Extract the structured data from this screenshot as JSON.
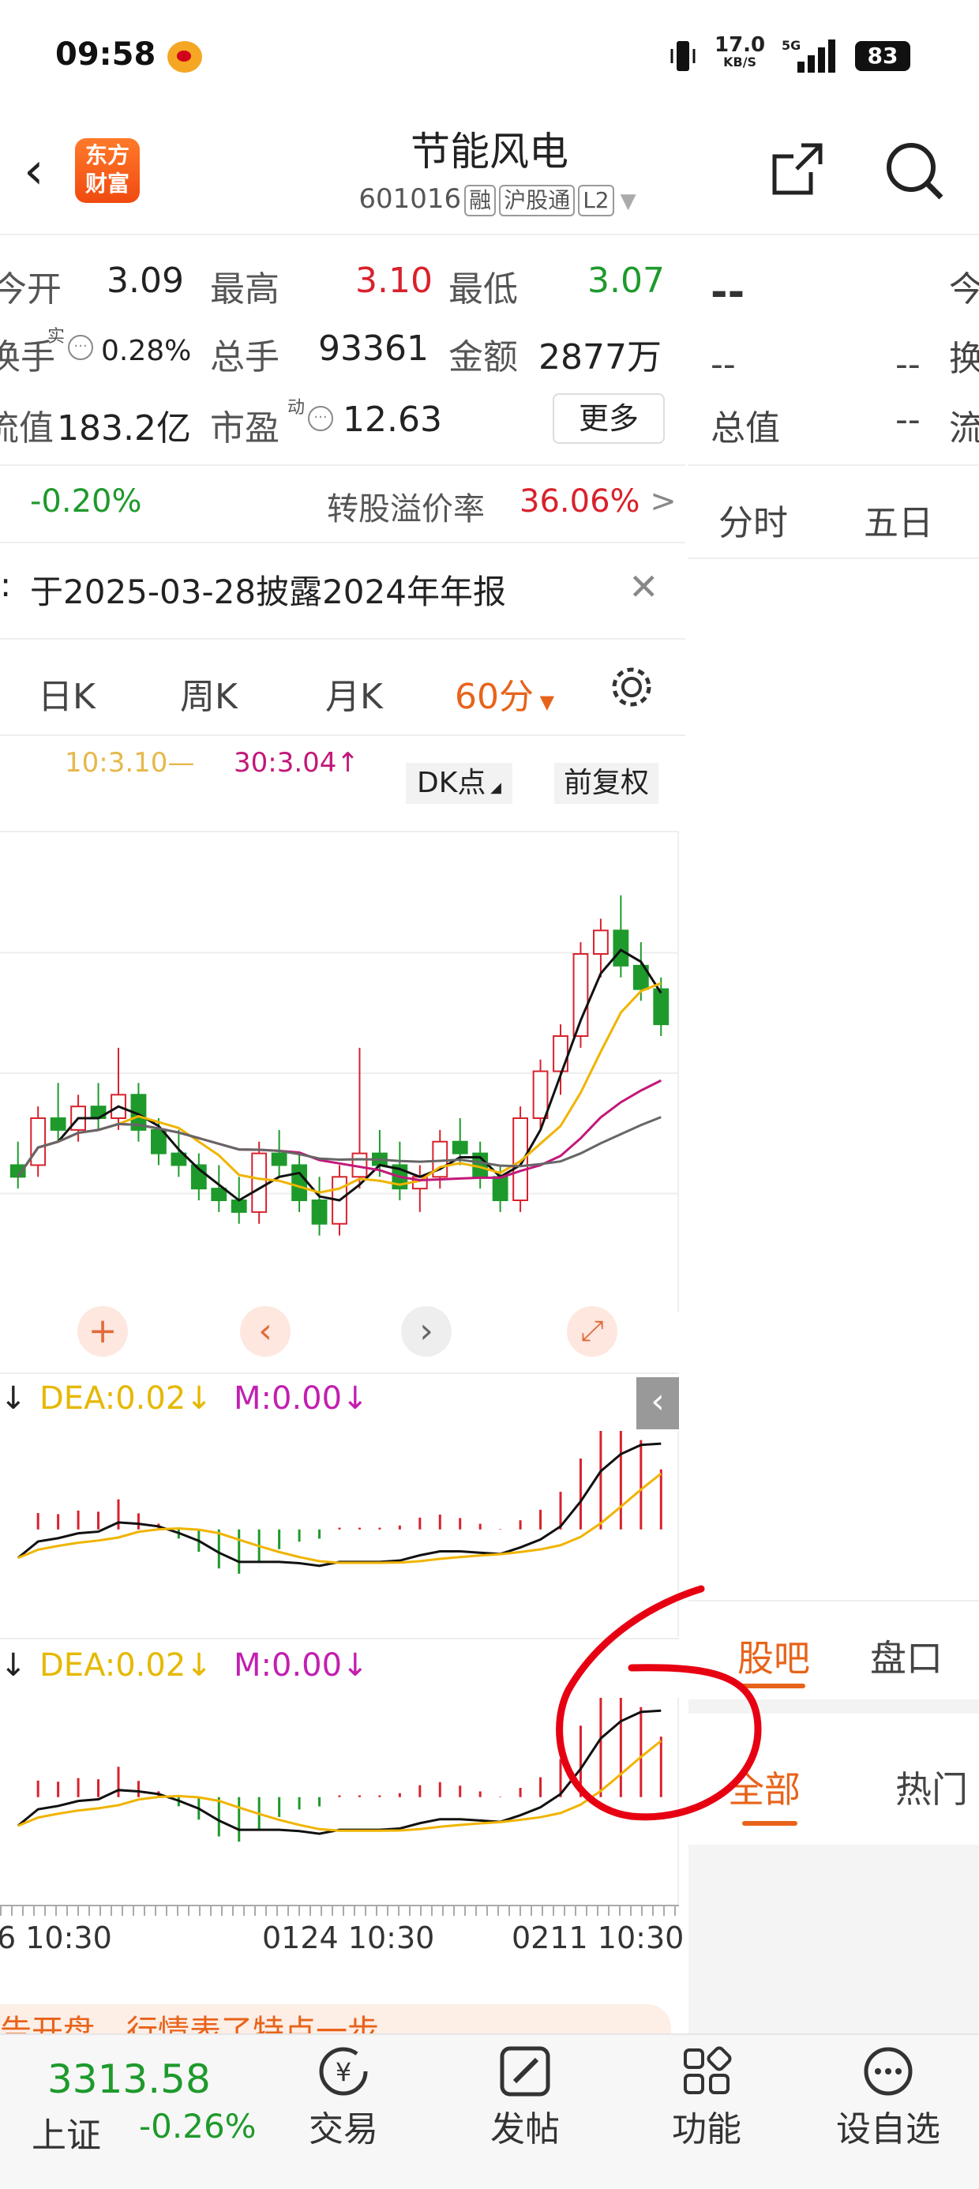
{
  "status": {
    "time": "09:58",
    "net_speed": "17.0",
    "net_unit": "KB/S",
    "battery": "83"
  },
  "header": {
    "logo_line1": "东方",
    "logo_line2": "财富",
    "title": "节能风电",
    "code": "601016",
    "tags": [
      "融",
      "沪股通",
      "L2"
    ]
  },
  "quote": {
    "open_label": "今开",
    "open": "3.09",
    "high_label": "最高",
    "high": "3.10",
    "low_label": "最低",
    "low": "3.07",
    "turnover_label": "换手",
    "turnover_sup": "实",
    "turnover": "0.28%",
    "volume_label": "总手",
    "volume": "93361",
    "amount_label": "金额",
    "amount": "2877万",
    "mktcap_label": "流值",
    "mktcap": "183.2亿",
    "pe_label": "市盈",
    "pe_sup": "动",
    "pe": "12.63",
    "more": "更多"
  },
  "bond": {
    "change": "-0.20%",
    "premium_label": "转股溢价率",
    "premium": "36.06%",
    "arrow": ">"
  },
  "notice": {
    "text": "于2025-03-28披露2024年年报",
    "prefix": ":"
  },
  "tabs": {
    "day": "日K",
    "week": "周K",
    "month": "月K",
    "min60": "60分"
  },
  "ma": {
    "ma10": "10:3.10—",
    "ma30": "30:3.04↑",
    "dk": "DK点",
    "adjust": "前复权"
  },
  "macd1": {
    "dea": "DEA:0.02↓",
    "m": "M:0.00↓"
  },
  "macd2": {
    "dea": "DEA:0.02↓",
    "m": "M:0.00↓"
  },
  "xaxis": {
    "t1": "6 10:30",
    "t2": "0124 10:30",
    "t3": "0211 10:30"
  },
  "banner": {
    "text": "告开盘，行情表了特点一步"
  },
  "right": {
    "dash": "--",
    "r1a": "--",
    "r1b": "--",
    "total_label": "总值",
    "total_val": "--",
    "tab1": "分时",
    "tab2": "五日",
    "c1": "今",
    "c2": "换",
    "c3": "流",
    "guba": "股吧",
    "pankou": "盘口",
    "all": "全部",
    "hot": "热门"
  },
  "nav": {
    "index_value": "3313.58",
    "index_name": "上证",
    "index_change": "-0.26%",
    "trade": "交易",
    "post": "发帖",
    "func": "功能",
    "watch": "设自选"
  },
  "colors": {
    "up": "#d8222c",
    "down": "#1e9a2c",
    "accent": "#e8631a"
  },
  "chart_data": {
    "type": "candlestick",
    "title": "",
    "interval": "60分",
    "indicators": [
      "MA10",
      "MA30",
      "MACD"
    ],
    "last_ma10": 3.1,
    "last_ma30": 3.04,
    "ylim": [
      2.9,
      3.25
    ],
    "candles": [
      [
        3.0,
        3.02,
        2.98,
        2.99
      ],
      [
        3.0,
        3.05,
        2.99,
        3.04
      ],
      [
        3.04,
        3.07,
        3.02,
        3.03
      ],
      [
        3.03,
        3.06,
        3.02,
        3.05
      ],
      [
        3.05,
        3.07,
        3.03,
        3.04
      ],
      [
        3.04,
        3.1,
        3.03,
        3.06
      ],
      [
        3.06,
        3.07,
        3.02,
        3.03
      ],
      [
        3.03,
        3.04,
        3.0,
        3.01
      ],
      [
        3.01,
        3.03,
        2.99,
        3.0
      ],
      [
        3.0,
        3.01,
        2.97,
        2.98
      ],
      [
        2.98,
        3.0,
        2.96,
        2.97
      ],
      [
        2.97,
        2.99,
        2.95,
        2.96
      ],
      [
        2.96,
        3.02,
        2.95,
        3.01
      ],
      [
        3.01,
        3.03,
        2.99,
        3.0
      ],
      [
        3.0,
        3.01,
        2.96,
        2.97
      ],
      [
        2.97,
        2.99,
        2.94,
        2.95
      ],
      [
        2.95,
        3.0,
        2.94,
        2.99
      ],
      [
        2.99,
        3.1,
        2.98,
        3.01
      ],
      [
        3.01,
        3.03,
        2.99,
        3.0
      ],
      [
        3.0,
        3.02,
        2.97,
        2.98
      ],
      [
        2.98,
        3.0,
        2.96,
        2.99
      ],
      [
        2.99,
        3.03,
        2.98,
        3.02
      ],
      [
        3.02,
        3.04,
        3.0,
        3.01
      ],
      [
        3.01,
        3.02,
        2.98,
        2.99
      ],
      [
        2.99,
        3.0,
        2.96,
        2.97
      ],
      [
        2.97,
        3.05,
        2.96,
        3.04
      ],
      [
        3.04,
        3.09,
        3.03,
        3.08
      ],
      [
        3.08,
        3.12,
        3.06,
        3.11
      ],
      [
        3.11,
        3.19,
        3.1,
        3.18
      ],
      [
        3.18,
        3.21,
        3.16,
        3.2
      ],
      [
        3.2,
        3.23,
        3.16,
        3.17
      ],
      [
        3.17,
        3.19,
        3.14,
        3.15
      ],
      [
        3.15,
        3.16,
        3.11,
        3.12
      ]
    ]
  }
}
